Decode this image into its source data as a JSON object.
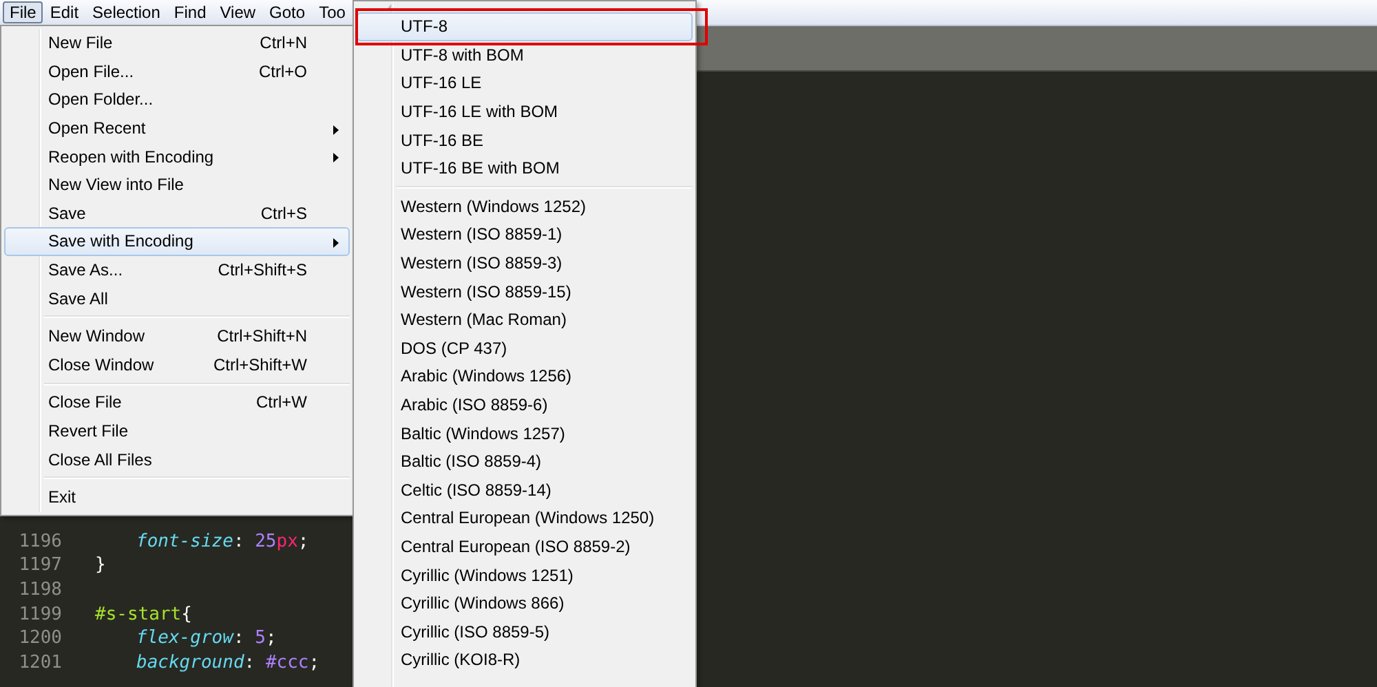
{
  "menubar": [
    {
      "label": "File",
      "selected": true
    },
    {
      "label": "Edit",
      "selected": false
    },
    {
      "label": "Selection",
      "selected": false
    },
    {
      "label": "Find",
      "selected": false
    },
    {
      "label": "View",
      "selected": false
    },
    {
      "label": "Goto",
      "selected": false
    },
    {
      "label": "Too",
      "selected": false
    }
  ],
  "file_menu": [
    {
      "kind": "item",
      "label": "New File",
      "shortcut": "Ctrl+N",
      "submenu": false,
      "selected": false
    },
    {
      "kind": "item",
      "label": "Open File...",
      "shortcut": "Ctrl+O",
      "submenu": false,
      "selected": false
    },
    {
      "kind": "item",
      "label": "Open Folder...",
      "submenu": false,
      "selected": false
    },
    {
      "kind": "item",
      "label": "Open Recent",
      "submenu": true,
      "selected": false
    },
    {
      "kind": "item",
      "label": "Reopen with Encoding",
      "submenu": true,
      "selected": false
    },
    {
      "kind": "item",
      "label": "New View into File",
      "submenu": false,
      "selected": false
    },
    {
      "kind": "item",
      "label": "Save",
      "shortcut": "Ctrl+S",
      "submenu": false,
      "selected": false
    },
    {
      "kind": "item",
      "label": "Save with Encoding",
      "submenu": true,
      "selected": true
    },
    {
      "kind": "item",
      "label": "Save As...",
      "shortcut": "Ctrl+Shift+S",
      "submenu": false,
      "selected": false
    },
    {
      "kind": "item",
      "label": "Save All",
      "submenu": false,
      "selected": false
    },
    {
      "kind": "separator"
    },
    {
      "kind": "item",
      "label": "New Window",
      "shortcut": "Ctrl+Shift+N",
      "submenu": false,
      "selected": false
    },
    {
      "kind": "item",
      "label": "Close Window",
      "shortcut": "Ctrl+Shift+W",
      "submenu": false,
      "selected": false
    },
    {
      "kind": "separator"
    },
    {
      "kind": "item",
      "label": "Close File",
      "shortcut": "Ctrl+W",
      "submenu": false,
      "selected": false
    },
    {
      "kind": "item",
      "label": "Revert File",
      "submenu": false,
      "selected": false
    },
    {
      "kind": "item",
      "label": "Close All Files",
      "submenu": false,
      "selected": false
    },
    {
      "kind": "separator"
    },
    {
      "kind": "item",
      "label": "Exit",
      "submenu": false,
      "selected": false
    }
  ],
  "encoding_menu": [
    {
      "kind": "item",
      "label": "UTF-8",
      "selected": true,
      "outlined": true
    },
    {
      "kind": "item",
      "label": "UTF-8 with BOM",
      "selected": false,
      "outlined": false
    },
    {
      "kind": "item",
      "label": "UTF-16 LE",
      "selected": false,
      "outlined": false
    },
    {
      "kind": "item",
      "label": "UTF-16 LE with BOM",
      "selected": false,
      "outlined": false
    },
    {
      "kind": "item",
      "label": "UTF-16 BE",
      "selected": false,
      "outlined": false
    },
    {
      "kind": "item",
      "label": "UTF-16 BE with BOM",
      "selected": false,
      "outlined": false
    },
    {
      "kind": "separator"
    },
    {
      "kind": "item",
      "label": "Western (Windows 1252)",
      "selected": false,
      "outlined": false
    },
    {
      "kind": "item",
      "label": "Western (ISO 8859-1)",
      "selected": false,
      "outlined": false
    },
    {
      "kind": "item",
      "label": "Western (ISO 8859-3)",
      "selected": false,
      "outlined": false
    },
    {
      "kind": "item",
      "label": "Western (ISO 8859-15)",
      "selected": false,
      "outlined": false
    },
    {
      "kind": "item",
      "label": "Western (Mac Roman)",
      "selected": false,
      "outlined": false
    },
    {
      "kind": "item",
      "label": "DOS (CP 437)",
      "selected": false,
      "outlined": false
    },
    {
      "kind": "item",
      "label": "Arabic (Windows 1256)",
      "selected": false,
      "outlined": false
    },
    {
      "kind": "item",
      "label": "Arabic (ISO 8859-6)",
      "selected": false,
      "outlined": false
    },
    {
      "kind": "item",
      "label": "Baltic (Windows 1257)",
      "selected": false,
      "outlined": false
    },
    {
      "kind": "item",
      "label": "Baltic (ISO 8859-4)",
      "selected": false,
      "outlined": false
    },
    {
      "kind": "item",
      "label": "Celtic (ISO 8859-14)",
      "selected": false,
      "outlined": false
    },
    {
      "kind": "item",
      "label": "Central European (Windows 1250)",
      "selected": false,
      "outlined": false
    },
    {
      "kind": "item",
      "label": "Central European (ISO 8859-2)",
      "selected": false,
      "outlined": false
    },
    {
      "kind": "item",
      "label": "Cyrillic (Windows 1251)",
      "selected": false,
      "outlined": false
    },
    {
      "kind": "item",
      "label": "Cyrillic (Windows 866)",
      "selected": false,
      "outlined": false
    },
    {
      "kind": "item",
      "label": "Cyrillic (ISO 8859-5)",
      "selected": false,
      "outlined": false
    },
    {
      "kind": "item",
      "label": "Cyrillic (KOI8-R)",
      "selected": false,
      "outlined": false
    }
  ],
  "code_lines": [
    {
      "number": "1196",
      "indent": true,
      "tokens": [
        {
          "kind": "property",
          "text": "font-size"
        },
        {
          "kind": "punct",
          "text": ": "
        },
        {
          "kind": "number",
          "text": "25"
        },
        {
          "kind": "unit",
          "text": "px"
        },
        {
          "kind": "punct",
          "text": ";"
        }
      ]
    },
    {
      "number": "1197",
      "indent": false,
      "tokens": [
        {
          "kind": "punct",
          "text": "}"
        }
      ]
    },
    {
      "number": "1198"
    },
    {
      "number": "1199",
      "indent": false,
      "tokens": [
        {
          "kind": "selector",
          "text": "#s-start"
        },
        {
          "kind": "punct",
          "text": "{"
        }
      ]
    },
    {
      "number": "1200",
      "indent": true,
      "tokens": [
        {
          "kind": "property",
          "text": "flex-grow"
        },
        {
          "kind": "punct",
          "text": ": "
        },
        {
          "kind": "number",
          "text": "5"
        },
        {
          "kind": "punct",
          "text": ";"
        }
      ]
    },
    {
      "number": "1201",
      "indent": true,
      "tokens": [
        {
          "kind": "property",
          "text": "background"
        },
        {
          "kind": "punct",
          "text": ": "
        },
        {
          "kind": "number",
          "text": "#ccc"
        },
        {
          "kind": "punct",
          "text": ";"
        }
      ]
    }
  ]
}
